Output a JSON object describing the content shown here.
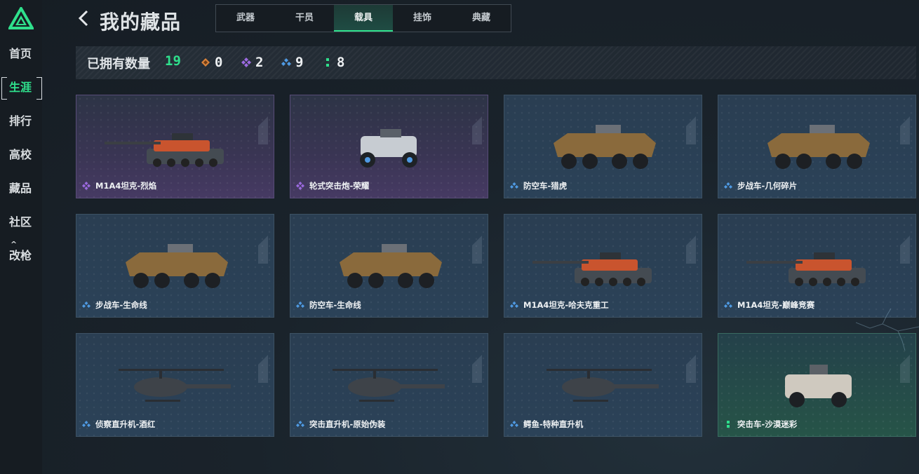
{
  "sidebar": {
    "items": [
      {
        "label": "首页",
        "active": false
      },
      {
        "label": "生涯",
        "active": true
      },
      {
        "label": "排行",
        "active": false
      },
      {
        "label": "高校",
        "active": false
      },
      {
        "label": "藏品",
        "active": false
      },
      {
        "label": "社区",
        "active": false,
        "caret": "^"
      },
      {
        "label": "改枪",
        "active": false
      }
    ]
  },
  "header": {
    "title": "我的藏品",
    "tabs": [
      "武器",
      "干员",
      "载具",
      "挂饰",
      "典藏"
    ],
    "active_tab": "载具"
  },
  "stats": {
    "owned_label": "已拥有数量",
    "owned_count": "19",
    "rarities": [
      {
        "icon": "orange-diamond-icon",
        "color": "#d9823a",
        "count": "0"
      },
      {
        "icon": "purple-diamond-icon",
        "color": "#9b6ae0",
        "count": "2"
      },
      {
        "icon": "blue-diamond-icon",
        "color": "#4f9ae3",
        "count": "9"
      },
      {
        "icon": "green-dots-icon",
        "color": "#2fe08c",
        "count": "8"
      }
    ]
  },
  "colors": {
    "accent": "#2fe08c",
    "purple_rarity": "#9b6ae0",
    "blue_rarity": "#4f9ae3",
    "green_rarity": "#2fe08c"
  },
  "cards": [
    {
      "name": "M1A4坦克-烈焰",
      "rarity": "purple",
      "vehicle": "tank"
    },
    {
      "name": "轮式突击炮-荣耀",
      "rarity": "purple",
      "vehicle": "buggy"
    },
    {
      "name": "防空车-猎虎",
      "rarity": "blue",
      "vehicle": "apc"
    },
    {
      "name": "步战车-几何碎片",
      "rarity": "blue",
      "vehicle": "apc"
    },
    {
      "name": "步战车-生命线",
      "rarity": "blue",
      "vehicle": "apc"
    },
    {
      "name": "防空车-生命线",
      "rarity": "blue",
      "vehicle": "apc"
    },
    {
      "name": "M1A4坦克-哈夫克重工",
      "rarity": "blue",
      "vehicle": "tank"
    },
    {
      "name": "M1A4坦克-巅峰竞赛",
      "rarity": "blue",
      "vehicle": "tank"
    },
    {
      "name": "侦察直升机-酒红",
      "rarity": "blue",
      "vehicle": "helicopter"
    },
    {
      "name": "突击直升机-原始伪装",
      "rarity": "blue",
      "vehicle": "helicopter"
    },
    {
      "name": "鳄鱼-特种直升机",
      "rarity": "blue",
      "vehicle": "helicopter"
    },
    {
      "name": "突击车-沙漠迷彩",
      "rarity": "green",
      "vehicle": "jeep"
    }
  ]
}
